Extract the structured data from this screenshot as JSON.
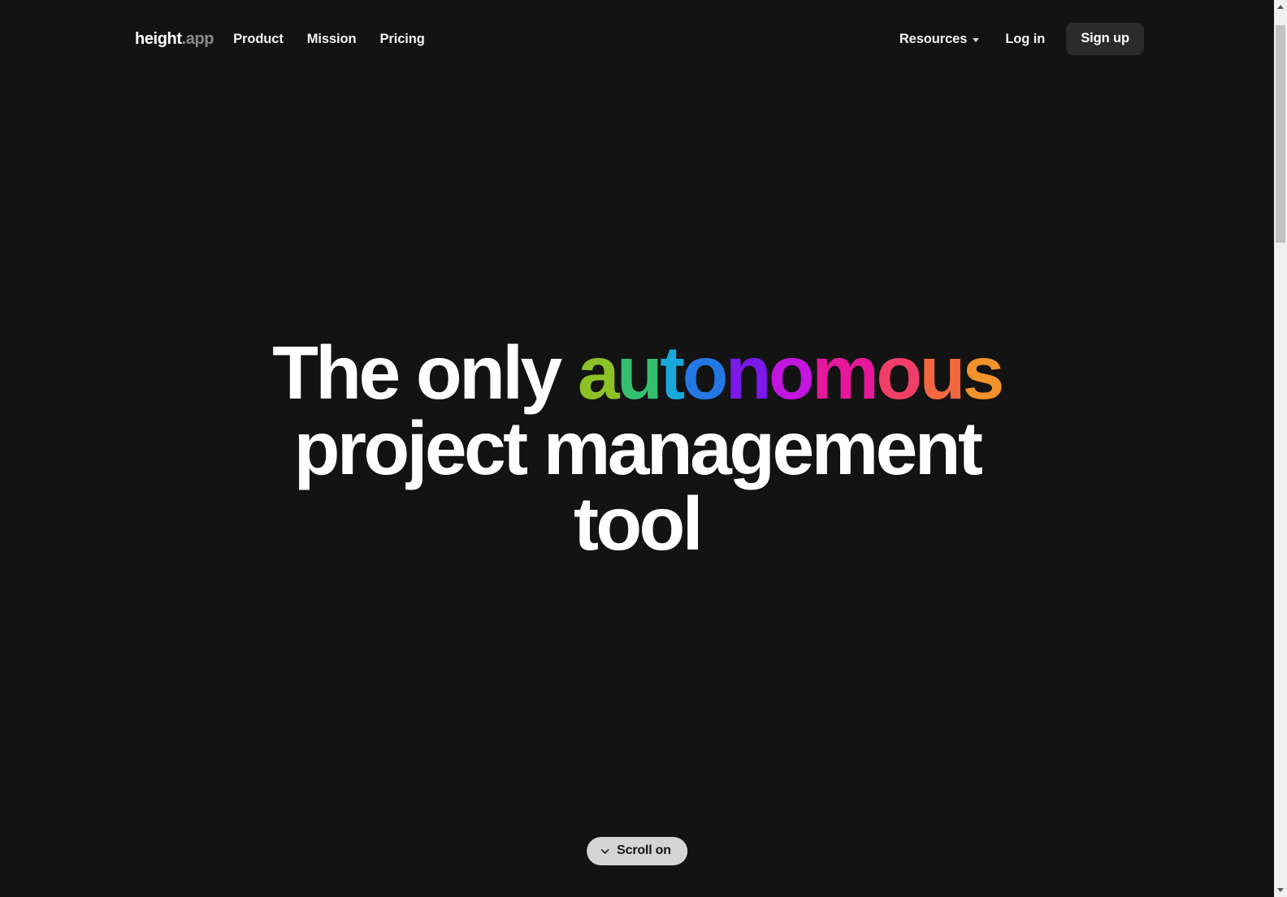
{
  "page": {
    "background_color": "#131313",
    "text_color": "#ffffff"
  },
  "navbar": {
    "logo_name": "height",
    "logo_suffix": ".app",
    "links": [
      {
        "label": "Product"
      },
      {
        "label": "Mission"
      },
      {
        "label": "Pricing"
      }
    ],
    "resources_label": "Resources",
    "resources_caret": "chevron-down-icon",
    "login_label": "Log in",
    "signup_label": "Sign up",
    "signup_bg": "#2b2b2b"
  },
  "hero": {
    "line1_plain": "The only ",
    "line2": "project management tool",
    "gradient_word": "autonomous",
    "gradient_letters": [
      {
        "char": "a",
        "color": "#8CC225"
      },
      {
        "char": "u",
        "color": "#35BE6E"
      },
      {
        "char": "t",
        "color": "#19A7DC"
      },
      {
        "char": "o",
        "color": "#2478E3"
      },
      {
        "char": "n",
        "color": "#7A19E8"
      },
      {
        "char": "o",
        "color": "#C315E0"
      },
      {
        "char": "m",
        "color": "#E5189B"
      },
      {
        "char": "o",
        "color": "#F03E68"
      },
      {
        "char": "u",
        "color": "#F2673E"
      },
      {
        "char": "s",
        "color": "#F2922A"
      }
    ]
  },
  "scroll_cta": {
    "label": "Scroll on",
    "icon": "chevron-down-icon",
    "bg": "#d4d4d4"
  },
  "scrollbar": {
    "up_arrow": "scroll-up-arrow-icon",
    "down_arrow": "scroll-down-arrow-icon",
    "thumb": "scrollbar-thumb"
  }
}
